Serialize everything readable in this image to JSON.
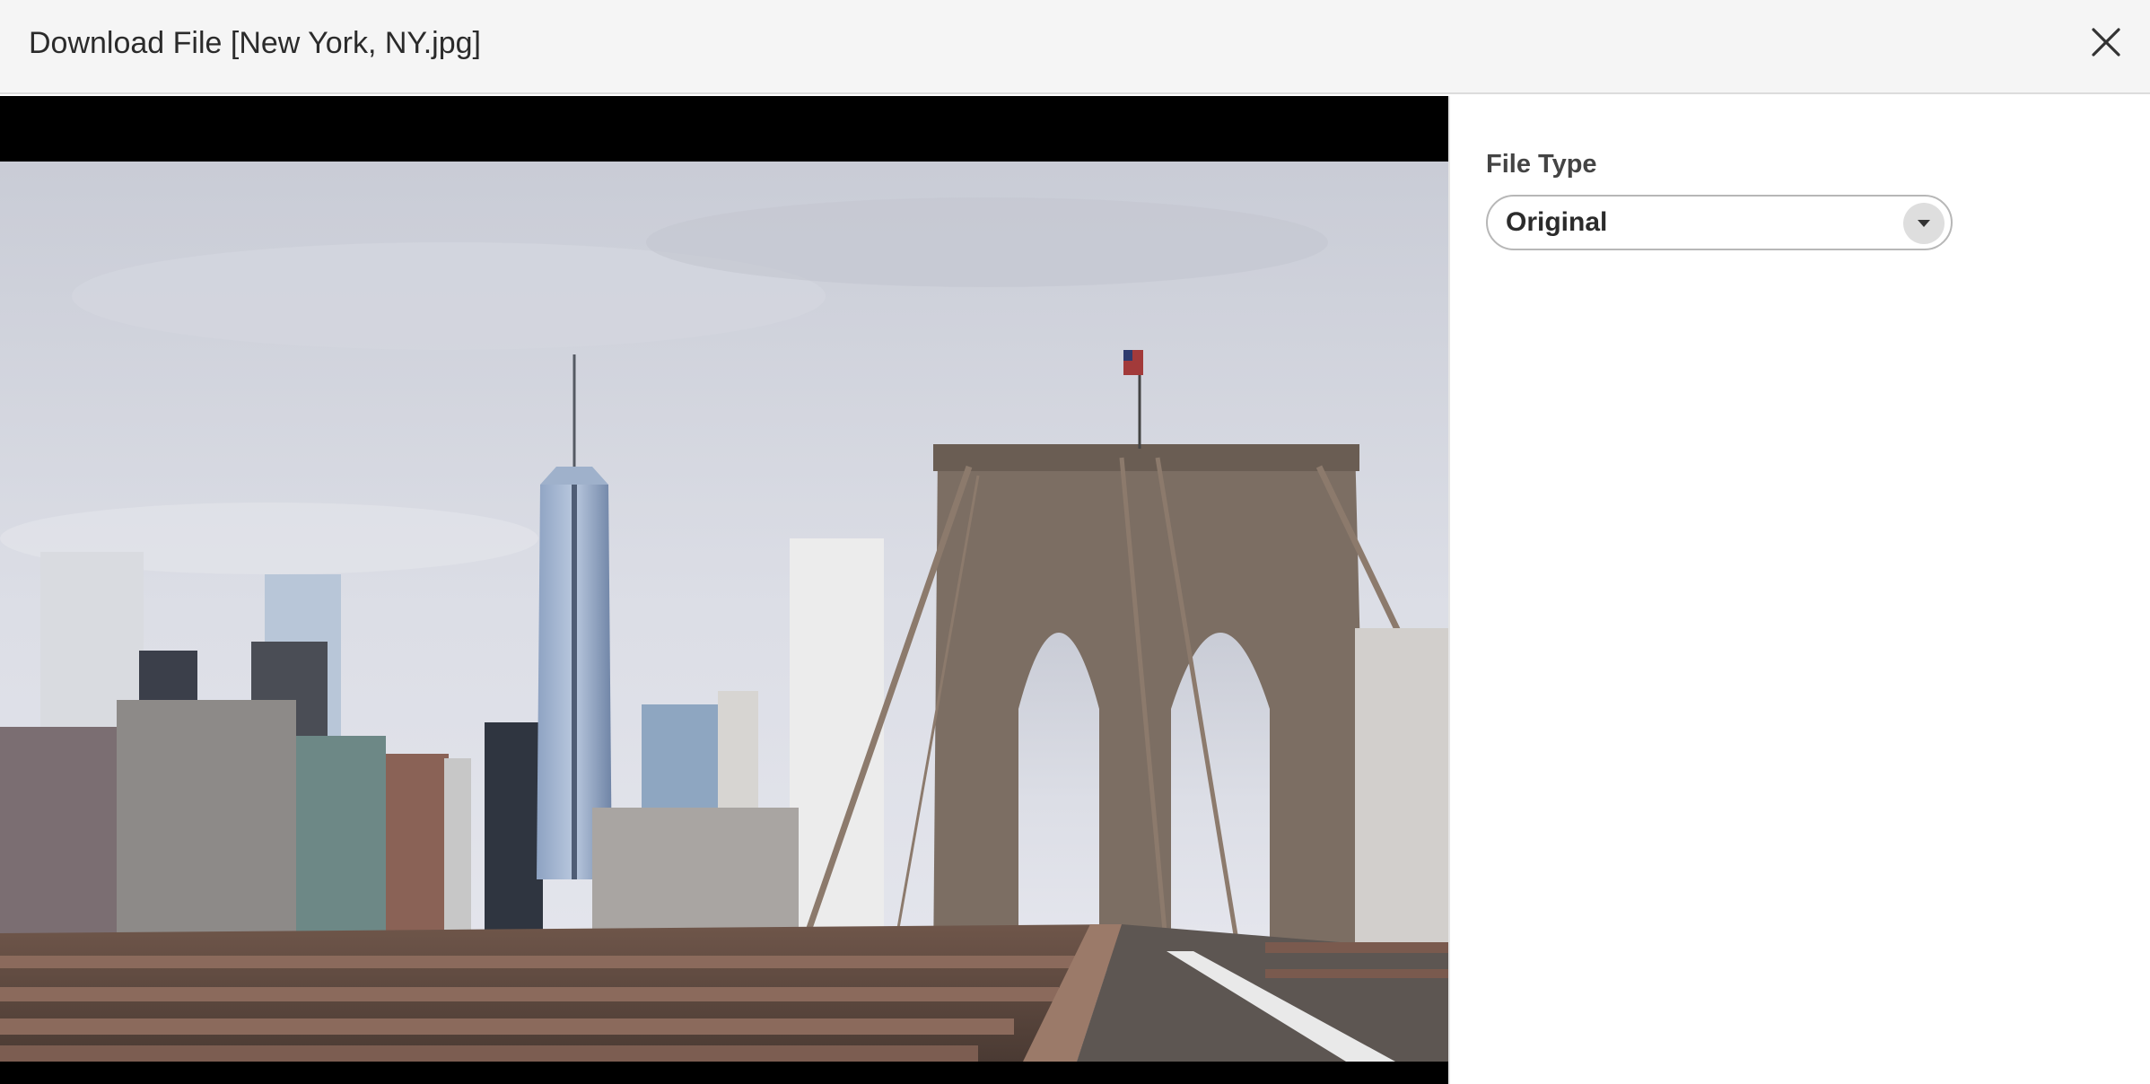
{
  "dialog": {
    "title": "Download File [New York, NY.jpg]",
    "close_icon": "close-icon"
  },
  "preview": {
    "subject": "city skyline and suspension bridge photo"
  },
  "options": {
    "file_type_label": "File Type",
    "file_type_value": "Original",
    "dropdown_icon": "chevron-down-icon"
  }
}
